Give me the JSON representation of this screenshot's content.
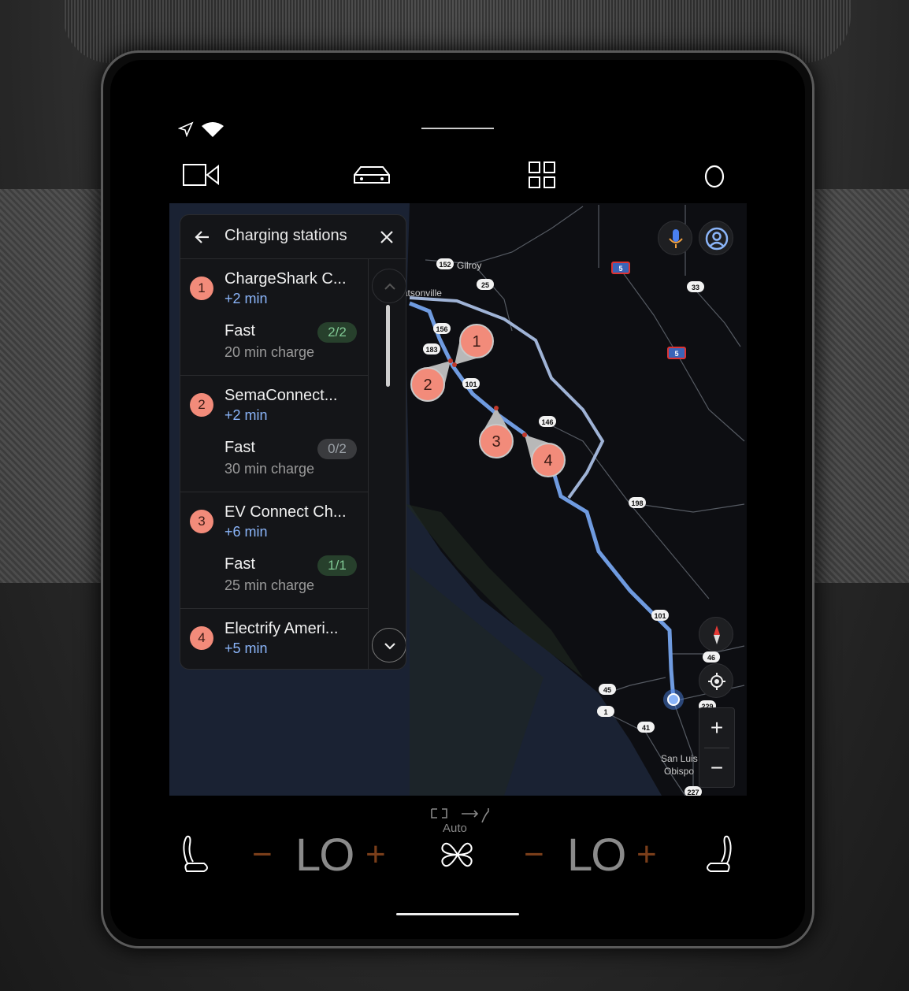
{
  "status": {
    "icons": [
      "navigation-arrow-icon",
      "wifi-icon"
    ]
  },
  "app_bar": {
    "icons": [
      "camera-icon",
      "car-icon",
      "apps-grid-icon",
      "assistant-circle-icon"
    ]
  },
  "panel": {
    "title": "Charging stations",
    "back_icon": "arrow-left-icon",
    "close_icon": "close-icon",
    "stations": [
      {
        "number": "1",
        "name": "ChargeShark C...",
        "detour": "+2 min",
        "speed": "Fast",
        "availability": "2/2",
        "charge_time": "20 min charge",
        "available": true
      },
      {
        "number": "2",
        "name": "SemaConnect...",
        "detour": "+2 min",
        "speed": "Fast",
        "availability": "0/2",
        "charge_time": "30 min charge",
        "available": false
      },
      {
        "number": "3",
        "name": "EV Connect Ch...",
        "detour": "+6 min",
        "speed": "Fast",
        "availability": "1/1",
        "charge_time": "25 min charge",
        "available": true
      },
      {
        "number": "4",
        "name": "Electrify Ameri...",
        "detour": "+5 min"
      }
    ]
  },
  "map": {
    "places": [
      "Gilroy",
      "Watsonville",
      "San Luis",
      "Obispo"
    ],
    "shields": [
      "152",
      "25",
      "156",
      "183",
      "101",
      "146",
      "198",
      "5",
      "5",
      "33",
      "101",
      "46",
      "45",
      "1",
      "41",
      "227",
      "229"
    ],
    "markers": [
      "1",
      "2",
      "3",
      "4"
    ],
    "route_color": "#6f9be0",
    "alt_route_color": "#9fb3d6",
    "marker_color": "#f28b7a",
    "zoom_in": "+",
    "zoom_out": "−",
    "controls": [
      "microphone-icon",
      "account-icon",
      "compass-icon",
      "my-location-icon"
    ]
  },
  "climate": {
    "left_temp": "LO",
    "right_temp": "LO",
    "fan_mode": "Auto",
    "minus": "−",
    "plus": "+",
    "accent": "#7a3e1a"
  }
}
